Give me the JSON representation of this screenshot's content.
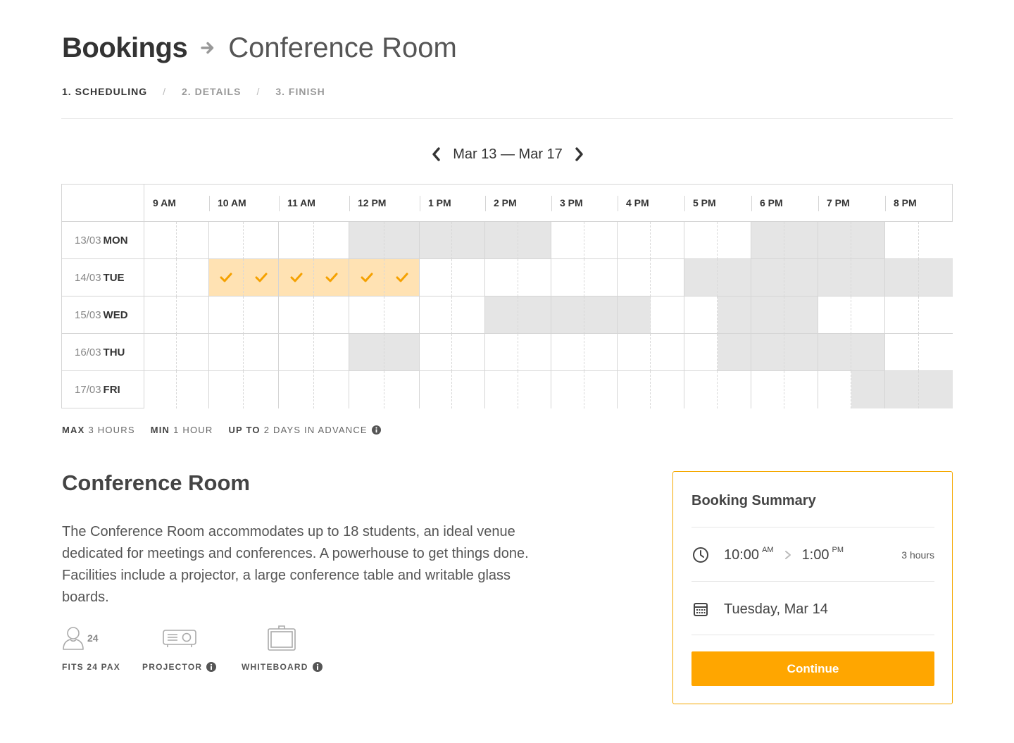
{
  "header": {
    "title": "Bookings",
    "subtitle": "Conference Room",
    "arrow_icon": "arrow-right-icon"
  },
  "steps": [
    {
      "label": "1. SCHEDULING",
      "active": true
    },
    {
      "label": "2. DETAILS",
      "active": false
    },
    {
      "label": "3. FINISH",
      "active": false
    }
  ],
  "step_separator": "/",
  "week_nav": {
    "range": "Mar 13 — Mar 17",
    "prev_icon": "chevron-left-icon",
    "next_icon": "chevron-right-icon"
  },
  "schedule": {
    "hours": [
      "9 AM",
      "10 AM",
      "11 AM",
      "12 PM",
      "1 PM",
      "2 PM",
      "3 PM",
      "4 PM",
      "5 PM",
      "6 PM",
      "7 PM",
      "8 PM"
    ],
    "days": [
      {
        "date": "13/03",
        "dow": "MON",
        "busy": [
          6,
          7,
          8,
          9,
          10,
          11,
          18,
          19,
          20,
          21
        ],
        "selected": []
      },
      {
        "date": "14/03",
        "dow": "TUE",
        "busy": [
          16,
          17,
          18,
          19,
          20,
          21,
          22,
          23
        ],
        "selected": [
          2,
          3,
          4,
          5,
          6,
          7
        ]
      },
      {
        "date": "15/03",
        "dow": "WED",
        "busy": [
          10,
          11,
          12,
          13,
          14,
          17,
          18,
          19
        ],
        "selected": []
      },
      {
        "date": "16/03",
        "dow": "THU",
        "busy": [
          6,
          7,
          17,
          18,
          19,
          20,
          21
        ],
        "selected": []
      },
      {
        "date": "17/03",
        "dow": "FRI",
        "busy": [
          21,
          22,
          23
        ],
        "selected": []
      }
    ],
    "colors": {
      "busy": "#e5e5e5",
      "selected": "#ffe2b3",
      "check": "#f5a100"
    }
  },
  "rules": [
    {
      "key": "MAX",
      "value": "3 HOURS",
      "info": false
    },
    {
      "key": "MIN",
      "value": "1 HOUR",
      "info": false
    },
    {
      "key": "UP TO",
      "value": "2 DAYS IN ADVANCE",
      "info": true
    }
  ],
  "room": {
    "title": "Conference Room",
    "description": "The Conference Room accommodates up to 18 students, an ideal venue dedicated for meetings and conferences. A powerhouse to get things done. Facilities include a projector, a large conference table and writable glass boards.",
    "pax_count": "24",
    "amenities": [
      {
        "label": "FITS 24 PAX",
        "icon": "person-icon",
        "info": false
      },
      {
        "label": "PROJECTOR",
        "icon": "projector-icon",
        "info": true
      },
      {
        "label": "WHITEBOARD",
        "icon": "whiteboard-icon",
        "info": true
      }
    ]
  },
  "summary": {
    "title": "Booking Summary",
    "start_time": "10:00",
    "start_period": "AM",
    "end_time": "1:00",
    "end_period": "PM",
    "duration": "3 hours",
    "date": "Tuesday, Mar 14",
    "clock_icon": "clock-icon",
    "calendar_icon": "calendar-icon",
    "continue_label": "Continue",
    "accent": "#ffa600"
  }
}
